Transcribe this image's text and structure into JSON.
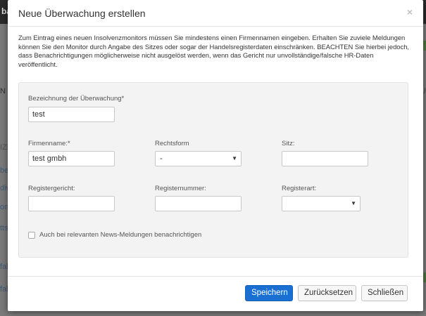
{
  "background": {
    "topbar_text": "ba",
    "left_items": [
      "N",
      "IZP",
      "ben",
      "div",
      "one",
      "ttsd",
      "fah",
      "fah"
    ],
    "right_text": "-SU"
  },
  "modal": {
    "title": "Neue Überwachung erstellen",
    "close_symbol": "×",
    "intro": "Zum Eintrag eines neuen Insolvenzmonitors müssen Sie mindestens einen Firmennamen eingeben. Erhalten Sie zuviele Meldungen können Sie den Monitor durch Angabe des Sitzes oder sogar der Handelsregisterdaten einschränken. BEACHTEN Sie hierbei jedoch, dass Benachrichtigungen möglicherweise nicht ausgelöst werden, wenn das Gericht nur unvollständige/falsche HR-Daten veröffentlicht.",
    "form": {
      "bezeichnung": {
        "label": "Bezeichnung der Überwachung*",
        "value": "test"
      },
      "firmenname": {
        "label": "Firmenname:*",
        "value": "test gmbh"
      },
      "rechtsform": {
        "label": "Rechtsform",
        "selected": "-"
      },
      "sitz": {
        "label": "Sitz:",
        "value": ""
      },
      "registergericht": {
        "label": "Registergericht:",
        "value": ""
      },
      "registernummer": {
        "label": "Registernummer:",
        "value": ""
      },
      "registerart": {
        "label": "Registerart:",
        "selected": ""
      },
      "news_checkbox": {
        "label": "Auch bei relevanten News-Meldungen benachrichtigen",
        "checked": false
      }
    },
    "buttons": {
      "save": "Speichern",
      "reset": "Zurücksetzen",
      "close": "Schließen"
    }
  },
  "colors": {
    "primary": "#1a6fd2",
    "well_bg": "#f3f3f3"
  }
}
